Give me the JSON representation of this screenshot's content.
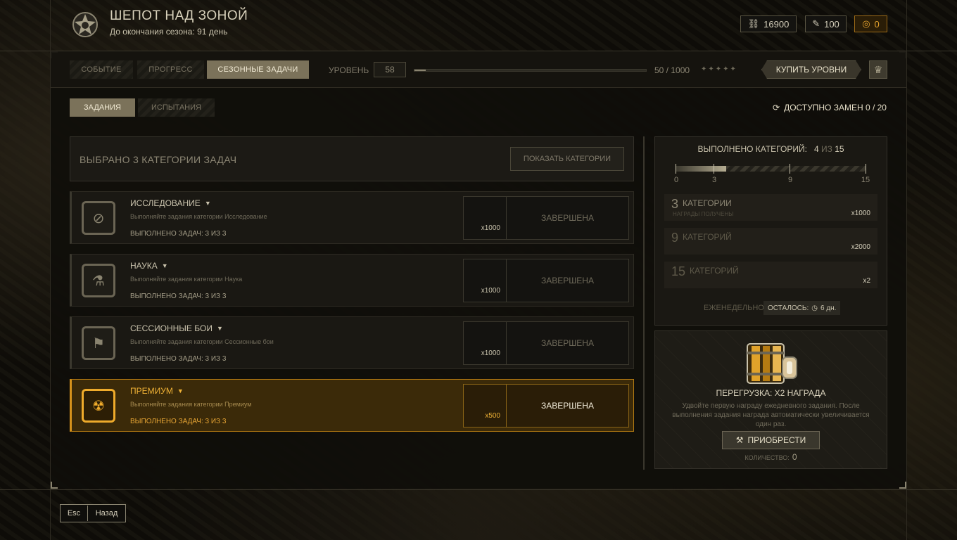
{
  "header": {
    "title": "ШЕПОТ НАД ЗОНОЙ",
    "subtitle": "До окончания сезона: 91 день",
    "currencies": [
      {
        "icon": "chain-icon",
        "value": "16900"
      },
      {
        "icon": "ticket-icon",
        "value": "100"
      },
      {
        "icon": "coin-icon",
        "value": "0",
        "color": "#e3a22e"
      }
    ]
  },
  "tabs": [
    {
      "label": "СОБЫТИЕ",
      "active": false
    },
    {
      "label": "ПРОГРЕСС",
      "active": false
    },
    {
      "label": "СЕЗОННЫЕ ЗАДАЧИ",
      "active": true
    }
  ],
  "level": {
    "label": "УРОВЕНЬ",
    "value": "58",
    "xp_text": "50 / 1000",
    "xp_fraction": 0.05,
    "stars": "✦✦✦✦✦"
  },
  "buy_levels_label": "КУПИТЬ УРОВНИ",
  "subtabs": [
    {
      "label": "ЗАДАНИЯ",
      "active": true
    },
    {
      "label": "ИСПЫТАНИЯ",
      "active": false
    }
  ],
  "replacements": "ДОСТУПНО ЗАМЕН 0 / 20",
  "categories_header": {
    "title": "ВЫБРАНО 3 КАТЕГОРИИ ЗАДАЧ",
    "show_button": "ПОКАЗАТЬ КАТЕГОРИИ"
  },
  "tasks": [
    {
      "icon": "compass-icon",
      "name": "ИССЛЕДОВАНИЕ",
      "desc": "Выполняйте задания категории Исследование",
      "done": "ВЫПОЛНЕНО ЗАДАЧ: 3 ИЗ 3",
      "reward": "x1000",
      "status": "ЗАВЕРШЕНА"
    },
    {
      "icon": "flask-icon",
      "name": "НАУКА",
      "desc": "Выполняйте задания категории Наука",
      "done": "ВЫПОЛНЕНО ЗАДАЧ: 3 ИЗ 3",
      "reward": "x1000",
      "status": "ЗАВЕРШЕНА"
    },
    {
      "icon": "flag-icon",
      "name": "СЕССИОННЫЕ БОИ",
      "desc": "Выполняйте задания категории Сессионные бои",
      "done": "ВЫПОЛНЕНО ЗАДАЧ: 3 ИЗ 3",
      "reward": "x1000",
      "status": "ЗАВЕРШЕНА"
    },
    {
      "icon": "radiation-icon",
      "name": "ПРЕМИУМ",
      "desc": "Выполняйте задания категории Премиум",
      "done": "ВЫПОЛНЕНО ЗАДАЧ: 3 ИЗ 3",
      "reward": "x500",
      "status": "ЗАВЕРШЕНА"
    }
  ],
  "progress_panel": {
    "title_prefix": "ВЫПОЛНЕНО КАТЕГОРИЙ:",
    "done": "4",
    "of": "ИЗ",
    "total": "15",
    "ticks": [
      "0",
      "3",
      "9",
      "15"
    ],
    "fill_fraction": 0.267,
    "tiers": [
      {
        "num": "3",
        "label": "КАТЕГОРИИ",
        "sub": "НАГРАДЫ ПОЛУЧЕНЫ",
        "mult": "x1000"
      },
      {
        "num": "9",
        "label": "КАТЕГОРИЙ",
        "sub": "",
        "mult": "x2000"
      },
      {
        "num": "15",
        "label": "КАТЕГОРИЙ",
        "sub": "",
        "mult": "x2"
      }
    ],
    "weekly": "ЕЖЕНЕДЕЛЬНО",
    "remaining_label": "ОСТАЛОСЬ:",
    "remaining_value": "6 дн."
  },
  "booster": {
    "title": "ПЕРЕГРУЗКА: X2 НАГРАДА",
    "desc": "Удвойте первую награду ежедневного задания. После выполнения задания награда автоматически увеличивается один раз.",
    "buy_label": "ПРИОБРЕСТИ",
    "qty_label": "КОЛИЧЕСТВО:",
    "qty_value": "0"
  },
  "bottom_nav": {
    "esc": "Esc",
    "back": "Назад"
  }
}
